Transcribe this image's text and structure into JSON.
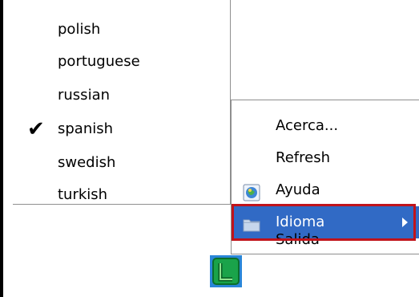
{
  "language_menu": {
    "items": [
      {
        "label": "polish",
        "checked": false
      },
      {
        "label": "portuguese",
        "checked": false
      },
      {
        "label": "russian",
        "checked": false
      },
      {
        "label": "spanish",
        "checked": true
      },
      {
        "label": "swedish",
        "checked": false
      },
      {
        "label": "turkish",
        "checked": false
      }
    ],
    "check_glyph": "✔"
  },
  "context_menu": {
    "items": [
      {
        "label": "Acerca...",
        "icon": null
      },
      {
        "label": "Refresh",
        "icon": null
      },
      {
        "label": "Ayuda",
        "icon": "help-globe-icon"
      },
      {
        "label": "Idioma",
        "icon": "folder-icon",
        "selected": true,
        "has_submenu": true
      },
      {
        "label": "Salida",
        "icon": null
      }
    ]
  },
  "colors": {
    "selection": "#316ac5",
    "highlight_border": "#c0131b",
    "tray_icon_green": "#1aa34a",
    "tray_icon_blue": "#2a86d8"
  }
}
